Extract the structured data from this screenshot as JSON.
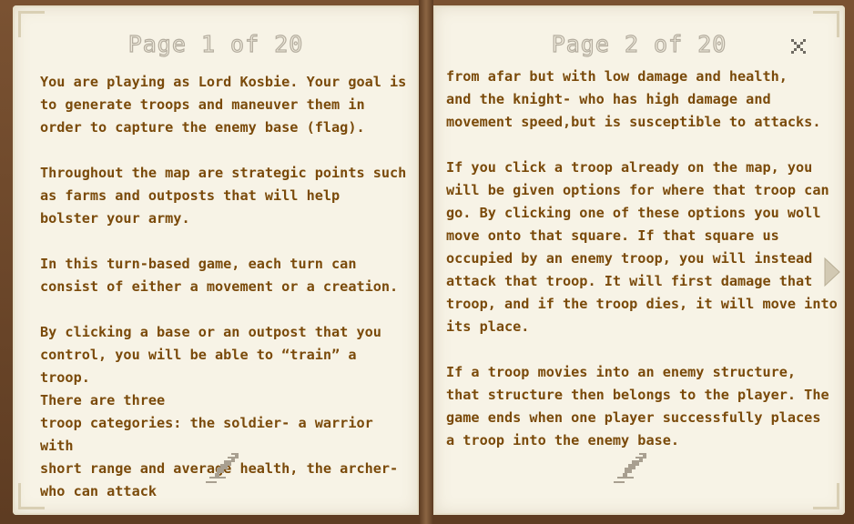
{
  "book": {
    "left_page": {
      "title": "Page 1 of 20",
      "text": "You are playing as Lord Kosbie. Your goal is\nto generate troops and maneuver them in\norder to capture the enemy base (flag).\n\nThroughout the map are strategic points such\nas farms and outposts that will help\nbolster your army.\n\nIn this turn-based game, each turn can\nconsist of either a movement or a creation.\n\nBy clicking a base or an outpost that you\ncontrol, you will be able to “train” a troop.\nThere are three\ntroop categories: the soldier- a warrior with\nshort range and average health, the archer-\nwho can attack"
    },
    "right_page": {
      "title": "Page 2 of 20",
      "text": "from afar but with low damage and health,\nand the knight- who has high damage and\nmovement speed,but is susceptible to attacks.\n\nIf you click a troop already on the map, you\nwill be given options for where that troop can\ngo. By clicking one of these options you woll\nmove onto that square. If that square us\noccupied by an enemy troop, you will instead\nattack that troop. It will first damage that\ntroop, and if the troop dies, it will move into\nits place.\n\nIf a troop movies into an enemy structure,\nthat structure then belongs to the player. The\ngame ends when one player successfully places\na troop into the enemy base."
    }
  },
  "icons": {
    "close": "close-icon",
    "next": "next-page-arrow-icon",
    "quill": "quill-icon"
  },
  "colors": {
    "text": "#7a4a0a",
    "page": "#f7f3e6",
    "cover": "#6e4a2c",
    "title": "#b4ad9f"
  }
}
